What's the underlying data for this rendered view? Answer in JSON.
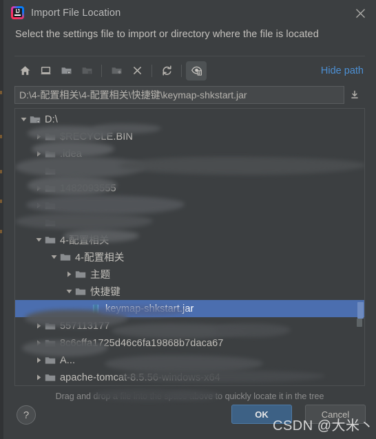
{
  "window": {
    "title": "Import File Location",
    "app_icon": "intellij-idea-icon",
    "icon_text": "IJ",
    "close_icon": "close-icon"
  },
  "subheader": {
    "text": "Select the settings file to import or directory where the file is located"
  },
  "toolbar": {
    "buttons": [
      {
        "name": "home-icon",
        "title": "Home",
        "enabled": true,
        "active": false
      },
      {
        "name": "desktop-icon",
        "title": "Desktop",
        "enabled": true,
        "active": false
      },
      {
        "name": "project-folder-icon",
        "title": "Project Directory",
        "enabled": true,
        "active": false
      },
      {
        "name": "module-folder-icon",
        "title": "Module Directory",
        "enabled": false,
        "active": false
      },
      {
        "name": "new-folder-icon",
        "title": "New Folder",
        "enabled": false,
        "active": false
      },
      {
        "name": "delete-icon",
        "title": "Delete",
        "enabled": true,
        "active": false
      },
      {
        "name": "refresh-icon",
        "title": "Refresh",
        "enabled": true,
        "active": false
      },
      {
        "name": "show-hidden-files-icon",
        "title": "Show Hidden Files",
        "enabled": true,
        "active": true
      }
    ],
    "hide_path_label": "Hide path"
  },
  "path": {
    "value": "D:\\4-配置相关\\4-配置相关\\快捷键\\keymap-shkstart.jar",
    "placeholder": "",
    "import_icon": "download-icon"
  },
  "tree": {
    "rows": [
      {
        "label": "D:\\",
        "indent": 0,
        "twisty": "down",
        "icon": "drive-folder-icon",
        "selected": false,
        "obscured": false
      },
      {
        "label": "$RECYCLE.BIN",
        "indent": 1,
        "twisty": "right",
        "icon": "folder-icon",
        "selected": false,
        "obscured": true
      },
      {
        "label": ".idea",
        "indent": 1,
        "twisty": "right",
        "icon": "folder-icon",
        "selected": false,
        "obscured": true
      },
      {
        "label": "",
        "indent": 1,
        "twisty": "none",
        "icon": "folder-icon",
        "selected": false,
        "obscured": true
      },
      {
        "label": "1482093555",
        "indent": 1,
        "twisty": "right",
        "icon": "folder-icon",
        "selected": false,
        "obscured": true
      },
      {
        "label": "",
        "indent": 1,
        "twisty": "right",
        "icon": "folder-icon",
        "selected": false,
        "obscured": true
      },
      {
        "label": "",
        "indent": 1,
        "twisty": "none",
        "icon": "folder-icon",
        "selected": false,
        "obscured": true
      },
      {
        "label": "4-配置相关",
        "indent": 1,
        "twisty": "down",
        "icon": "folder-icon",
        "selected": false,
        "obscured": true
      },
      {
        "label": "4-配置相关",
        "indent": 2,
        "twisty": "down",
        "icon": "folder-icon",
        "selected": false,
        "obscured": false
      },
      {
        "label": "主题",
        "indent": 3,
        "twisty": "right",
        "icon": "folder-icon",
        "selected": false,
        "obscured": false
      },
      {
        "label": "快捷键",
        "indent": 3,
        "twisty": "down",
        "icon": "folder-icon",
        "selected": false,
        "obscured": false
      },
      {
        "label": "keymap-shkstart.jar",
        "indent": 4,
        "twisty": "none",
        "icon": "jar-file-icon",
        "selected": true,
        "obscured": false
      },
      {
        "label": "557113177",
        "indent": 1,
        "twisty": "right",
        "icon": "folder-icon",
        "selected": false,
        "obscured": true
      },
      {
        "label": "8c6cffa1725d46c6fa19868b7daca67",
        "indent": 1,
        "twisty": "right",
        "icon": "folder-icon",
        "selected": false,
        "obscured": true
      },
      {
        "label": "A...",
        "indent": 1,
        "twisty": "right",
        "icon": "folder-icon",
        "selected": false,
        "obscured": true
      },
      {
        "label": "apache-tomcat-8.5.56-windows-x64",
        "indent": 1,
        "twisty": "right",
        "icon": "folder-icon",
        "selected": false,
        "obscured": true
      }
    ],
    "scrollbar": "vertical-scrollbar-thumb"
  },
  "hint": {
    "text": "Drag and drop a file into the space above to quickly locate it in the tree"
  },
  "footer": {
    "help_label": "?",
    "ok_label": "OK",
    "cancel_label": "Cancel"
  },
  "watermark": {
    "text": "CSDN @大米丶"
  },
  "colors": {
    "dialog_bg": "#3c3f41",
    "selection_blue": "#4b6eaf",
    "link_blue": "#4d90d4",
    "ok_button": "#3d6185",
    "text": "#c3c0bb"
  }
}
